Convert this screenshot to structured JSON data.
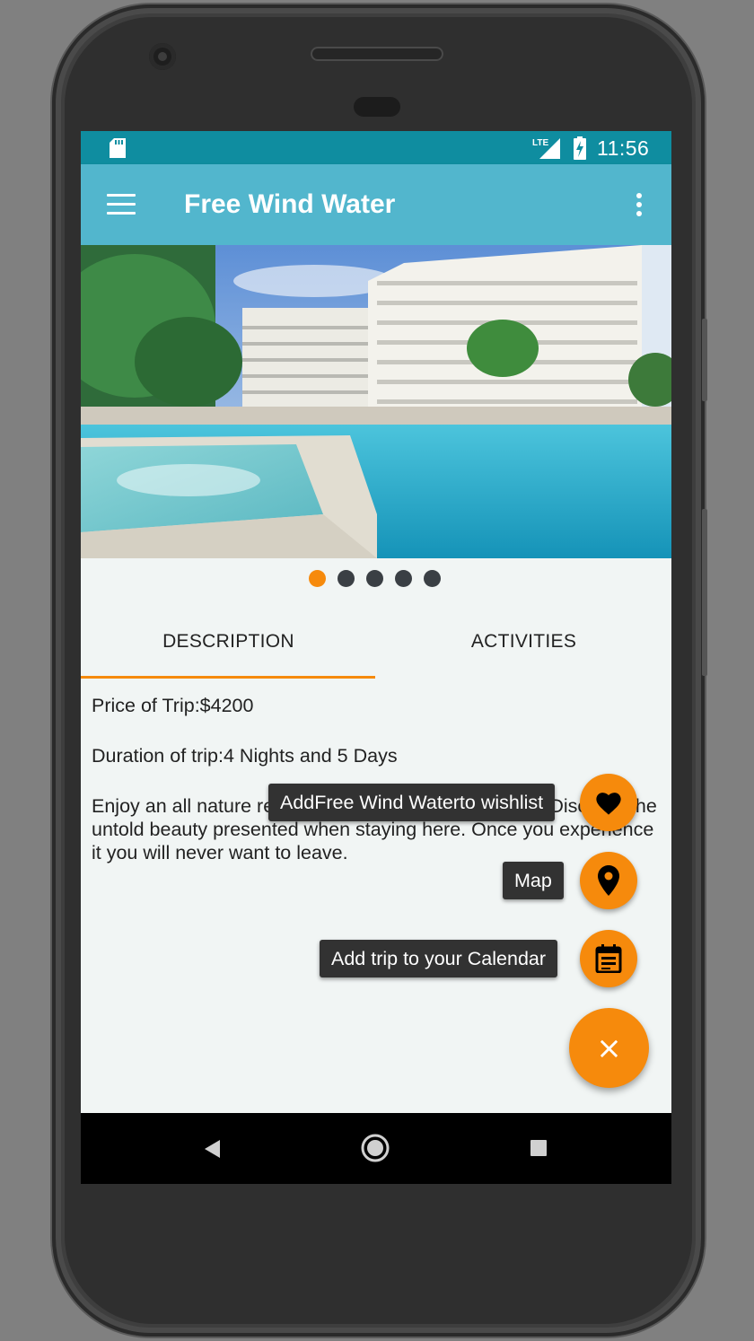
{
  "status_bar": {
    "time": "11:56",
    "network": "LTE"
  },
  "app_bar": {
    "title": "Free Wind Water",
    "menu_icon": "hamburger-menu-icon",
    "overflow_icon": "more-vert-icon"
  },
  "carousel": {
    "total": 5,
    "active_index": 0
  },
  "tabs": [
    {
      "label": "DESCRIPTION",
      "selected": true
    },
    {
      "label": "ACTIVITIES",
      "selected": false
    }
  ],
  "description": {
    "price": "Price of Trip:$4200",
    "duration": "Duration of trip:4 Nights and 5 Days",
    "text": "Enjoy an all nature re… …us…nd to generate power. Discover the untold beauty presented when staying here. Once you experience it you will never want to leave."
  },
  "fab_menu": {
    "wishlist": {
      "label": "AddFree Wind Waterto wishlist",
      "icon": "heart-icon"
    },
    "map": {
      "label": "Map",
      "icon": "location-pin-icon"
    },
    "calendar": {
      "label": "Add trip to your Calendar",
      "icon": "calendar-icon"
    },
    "main": {
      "icon": "close-icon",
      "glyph": "×"
    }
  },
  "colors": {
    "accent": "#f68a0c",
    "primary": "#52b6cd",
    "status_bar": "#0f8da0"
  }
}
